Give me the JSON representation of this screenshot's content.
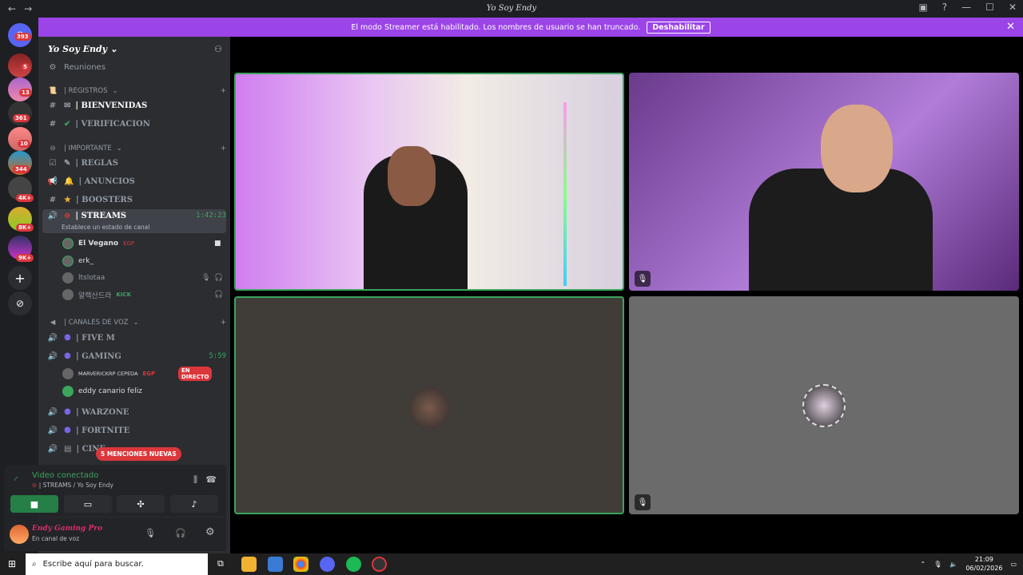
{
  "window": {
    "title": "Yo Soy Endy"
  },
  "banner": {
    "text": "El modo Streamer está habilitado. Los nombres de usuario se han truncado.",
    "button": "Deshabilitar"
  },
  "servers": {
    "badges": [
      "393",
      "5",
      "13",
      "361",
      "10",
      "344",
      "4K+",
      "8K+",
      "9K+"
    ]
  },
  "sidebar": {
    "server_name": "Yo Soy Endy",
    "meetings": "Reuniones",
    "cat_registros": "| REGISTROS",
    "ch_bienvenidas": "| BIENVENIDAS",
    "ch_verificacion": "| VERIFICACION",
    "cat_importante": "| IMPORTANTE",
    "ch_reglas": "| REGLAS",
    "ch_anuncios": "| ANUNCIOS",
    "ch_boosters": "| BOOSTERS",
    "ch_streams": "| STREAMS",
    "streams_time": "1:42:23",
    "streams_status": "Establece un estado de canal",
    "users": [
      {
        "name": "El Vegano",
        "tag": "EGP"
      },
      {
        "name": "erk_",
        "tag": ""
      },
      {
        "name": "ltslotaa",
        "tag": ""
      },
      {
        "name": "알랙산드라",
        "tag": "KICK"
      }
    ],
    "cat_voz": "| CANALES DE VOZ",
    "ch_fivem": "| FIVE M",
    "ch_gaming": "| GAMING",
    "gaming_time": "5:59",
    "gaming_users": [
      {
        "name": "MARVERICKRP CEPEDA",
        "tag": "EGP",
        "live": "EN DIRECTO"
      },
      {
        "name": "eddy canario feliz",
        "tag": "",
        "live": ""
      }
    ],
    "ch_warzone": "| WARZONE",
    "ch_fortnite": "| FORTNITE",
    "ch_cine": "| CINE",
    "new_mentions": "5 MENCIONES NUEVAS"
  },
  "voice": {
    "status": "Video conectado",
    "channel": "| STREAMS / Yo Soy Endy"
  },
  "user": {
    "name": "Endy Gaming Pro",
    "status": "En canal de voz"
  },
  "taskbar": {
    "search": "Escribe aquí para buscar.",
    "time": "21:09",
    "date": "06/02/2026"
  }
}
